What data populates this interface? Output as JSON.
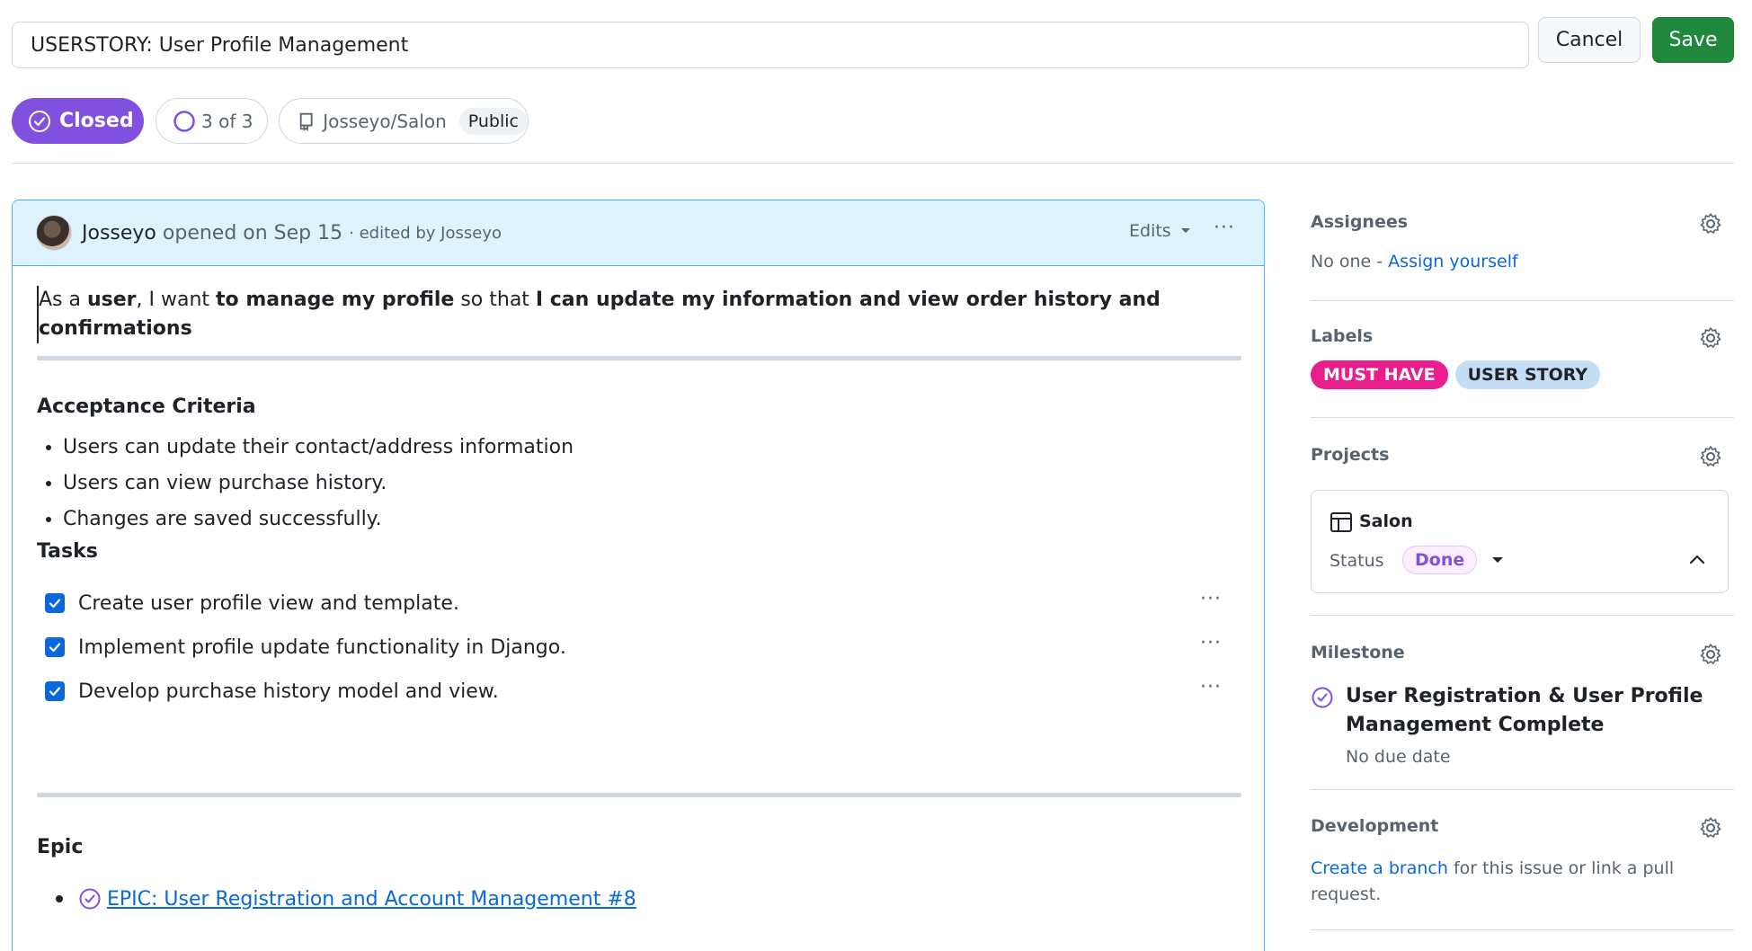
{
  "header": {
    "title_value": "USERSTORY: User Profile Management",
    "cancel_label": "Cancel",
    "save_label": "Save"
  },
  "status_row": {
    "state": "Closed",
    "progress": "3 of 3",
    "repo": "Josseyo/Salon",
    "visibility": "Public"
  },
  "comment": {
    "author": "Josseyo",
    "opened": "opened on Sep 15",
    "edited": "· edited by Josseyo",
    "edits_label": "Edits",
    "menu": "···",
    "story": {
      "p1": "As a ",
      "b1": "user",
      "p2": ", I want ",
      "b2": "to manage my profile",
      "p3": " so that ",
      "b3": "I can update my information and view order history and confirmations"
    },
    "acceptance_heading": "Acceptance Criteria",
    "criteria": [
      "Users can update their contact/address information",
      "Users can view purchase history.",
      "Changes are saved successfully."
    ],
    "tasks_heading": "Tasks",
    "tasks": [
      {
        "label": "Create user profile view and template.",
        "checked": true
      },
      {
        "label": "Implement profile update functionality in Django.",
        "checked": true
      },
      {
        "label": "Develop purchase history model and view.",
        "checked": true
      }
    ],
    "task_menu": "···",
    "epic_heading": "Epic",
    "epic_link": "EPIC: User Registration and Account Management #8"
  },
  "sidebar": {
    "assignees": {
      "title": "Assignees",
      "none_text": "No one - ",
      "assign_link": "Assign yourself"
    },
    "labels": {
      "title": "Labels",
      "items": [
        {
          "name": "MUST HAVE",
          "bg": "#e91e8c",
          "fg": "#ffffff"
        },
        {
          "name": "USER STORY",
          "bg": "#c5def5",
          "fg": "#1f2328"
        }
      ]
    },
    "projects": {
      "title": "Projects",
      "name": "Salon",
      "status_label": "Status",
      "status_value": "Done"
    },
    "milestone": {
      "title": "Milestone",
      "name": "User Registration & User Profile Management Complete",
      "due": "No due date"
    },
    "development": {
      "title": "Development",
      "create_link": "Create a branch",
      "rest": " for this issue or link a pull request."
    }
  },
  "colors": {
    "accent_purple": "#8250df",
    "save_green": "#1f883d",
    "link_blue": "#0969da",
    "header_blue": "#ddf4ff"
  }
}
